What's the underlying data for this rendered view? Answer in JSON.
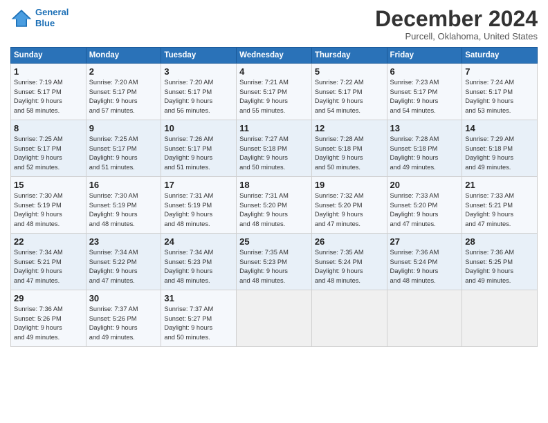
{
  "header": {
    "logo_line1": "General",
    "logo_line2": "Blue",
    "month": "December 2024",
    "location": "Purcell, Oklahoma, United States"
  },
  "weekdays": [
    "Sunday",
    "Monday",
    "Tuesday",
    "Wednesday",
    "Thursday",
    "Friday",
    "Saturday"
  ],
  "weeks": [
    [
      {
        "day": "1",
        "info": "Sunrise: 7:19 AM\nSunset: 5:17 PM\nDaylight: 9 hours\nand 58 minutes."
      },
      {
        "day": "2",
        "info": "Sunrise: 7:20 AM\nSunset: 5:17 PM\nDaylight: 9 hours\nand 57 minutes."
      },
      {
        "day": "3",
        "info": "Sunrise: 7:20 AM\nSunset: 5:17 PM\nDaylight: 9 hours\nand 56 minutes."
      },
      {
        "day": "4",
        "info": "Sunrise: 7:21 AM\nSunset: 5:17 PM\nDaylight: 9 hours\nand 55 minutes."
      },
      {
        "day": "5",
        "info": "Sunrise: 7:22 AM\nSunset: 5:17 PM\nDaylight: 9 hours\nand 54 minutes."
      },
      {
        "day": "6",
        "info": "Sunrise: 7:23 AM\nSunset: 5:17 PM\nDaylight: 9 hours\nand 54 minutes."
      },
      {
        "day": "7",
        "info": "Sunrise: 7:24 AM\nSunset: 5:17 PM\nDaylight: 9 hours\nand 53 minutes."
      }
    ],
    [
      {
        "day": "8",
        "info": "Sunrise: 7:25 AM\nSunset: 5:17 PM\nDaylight: 9 hours\nand 52 minutes."
      },
      {
        "day": "9",
        "info": "Sunrise: 7:25 AM\nSunset: 5:17 PM\nDaylight: 9 hours\nand 51 minutes."
      },
      {
        "day": "10",
        "info": "Sunrise: 7:26 AM\nSunset: 5:17 PM\nDaylight: 9 hours\nand 51 minutes."
      },
      {
        "day": "11",
        "info": "Sunrise: 7:27 AM\nSunset: 5:18 PM\nDaylight: 9 hours\nand 50 minutes."
      },
      {
        "day": "12",
        "info": "Sunrise: 7:28 AM\nSunset: 5:18 PM\nDaylight: 9 hours\nand 50 minutes."
      },
      {
        "day": "13",
        "info": "Sunrise: 7:28 AM\nSunset: 5:18 PM\nDaylight: 9 hours\nand 49 minutes."
      },
      {
        "day": "14",
        "info": "Sunrise: 7:29 AM\nSunset: 5:18 PM\nDaylight: 9 hours\nand 49 minutes."
      }
    ],
    [
      {
        "day": "15",
        "info": "Sunrise: 7:30 AM\nSunset: 5:19 PM\nDaylight: 9 hours\nand 48 minutes."
      },
      {
        "day": "16",
        "info": "Sunrise: 7:30 AM\nSunset: 5:19 PM\nDaylight: 9 hours\nand 48 minutes."
      },
      {
        "day": "17",
        "info": "Sunrise: 7:31 AM\nSunset: 5:19 PM\nDaylight: 9 hours\nand 48 minutes."
      },
      {
        "day": "18",
        "info": "Sunrise: 7:31 AM\nSunset: 5:20 PM\nDaylight: 9 hours\nand 48 minutes."
      },
      {
        "day": "19",
        "info": "Sunrise: 7:32 AM\nSunset: 5:20 PM\nDaylight: 9 hours\nand 47 minutes."
      },
      {
        "day": "20",
        "info": "Sunrise: 7:33 AM\nSunset: 5:20 PM\nDaylight: 9 hours\nand 47 minutes."
      },
      {
        "day": "21",
        "info": "Sunrise: 7:33 AM\nSunset: 5:21 PM\nDaylight: 9 hours\nand 47 minutes."
      }
    ],
    [
      {
        "day": "22",
        "info": "Sunrise: 7:34 AM\nSunset: 5:21 PM\nDaylight: 9 hours\nand 47 minutes."
      },
      {
        "day": "23",
        "info": "Sunrise: 7:34 AM\nSunset: 5:22 PM\nDaylight: 9 hours\nand 47 minutes."
      },
      {
        "day": "24",
        "info": "Sunrise: 7:34 AM\nSunset: 5:23 PM\nDaylight: 9 hours\nand 48 minutes."
      },
      {
        "day": "25",
        "info": "Sunrise: 7:35 AM\nSunset: 5:23 PM\nDaylight: 9 hours\nand 48 minutes."
      },
      {
        "day": "26",
        "info": "Sunrise: 7:35 AM\nSunset: 5:24 PM\nDaylight: 9 hours\nand 48 minutes."
      },
      {
        "day": "27",
        "info": "Sunrise: 7:36 AM\nSunset: 5:24 PM\nDaylight: 9 hours\nand 48 minutes."
      },
      {
        "day": "28",
        "info": "Sunrise: 7:36 AM\nSunset: 5:25 PM\nDaylight: 9 hours\nand 49 minutes."
      }
    ],
    [
      {
        "day": "29",
        "info": "Sunrise: 7:36 AM\nSunset: 5:26 PM\nDaylight: 9 hours\nand 49 minutes."
      },
      {
        "day": "30",
        "info": "Sunrise: 7:37 AM\nSunset: 5:26 PM\nDaylight: 9 hours\nand 49 minutes."
      },
      {
        "day": "31",
        "info": "Sunrise: 7:37 AM\nSunset: 5:27 PM\nDaylight: 9 hours\nand 50 minutes."
      },
      {
        "day": "",
        "info": ""
      },
      {
        "day": "",
        "info": ""
      },
      {
        "day": "",
        "info": ""
      },
      {
        "day": "",
        "info": ""
      }
    ]
  ]
}
